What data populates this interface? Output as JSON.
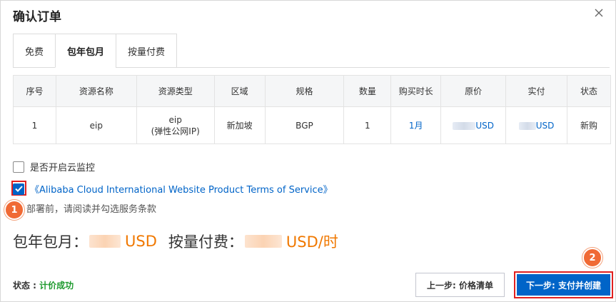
{
  "dialog": {
    "title": "确认订单"
  },
  "tabs": [
    {
      "label": "免费"
    },
    {
      "label": "包年包月",
      "active": true
    },
    {
      "label": "按量付费"
    }
  ],
  "table": {
    "headers": [
      "序号",
      "资源名称",
      "资源类型",
      "区域",
      "规格",
      "数量",
      "购买时长",
      "原价",
      "实付",
      "状态"
    ],
    "row": {
      "index": "1",
      "name": "eip",
      "type_line1": "eip",
      "type_line2": "(弹性公网IP)",
      "region": "新加坡",
      "spec": "BGP",
      "quantity": "1",
      "duration": "1月",
      "original_price_unit": "USD",
      "paid_price_unit": "USD",
      "status": "新购"
    }
  },
  "options": {
    "monitor_label": "是否开启云监控",
    "monitor_checked": false,
    "terms_label": "《Alibaba Cloud International Website Product Terms of Service》",
    "terms_checked": true,
    "hint": "部署前，请阅读并勾选服务条款"
  },
  "prices": {
    "subscription_label": "包年包月：",
    "subscription_unit": "USD",
    "payg_label": "按量付费：",
    "payg_unit": "USD/时"
  },
  "footer": {
    "status_label": "状态 : ",
    "status_value": "计价成功",
    "prev_button": "上一步: 价格清单",
    "next_button": "下一步: 支付并创建"
  },
  "annotations": {
    "badge_1": "1",
    "badge_2": "2"
  },
  "colors": {
    "primary": "#0064c8",
    "price": "#f07800",
    "success": "#1e9a2e",
    "highlight": "#e02020",
    "badge": "#f06a35"
  }
}
